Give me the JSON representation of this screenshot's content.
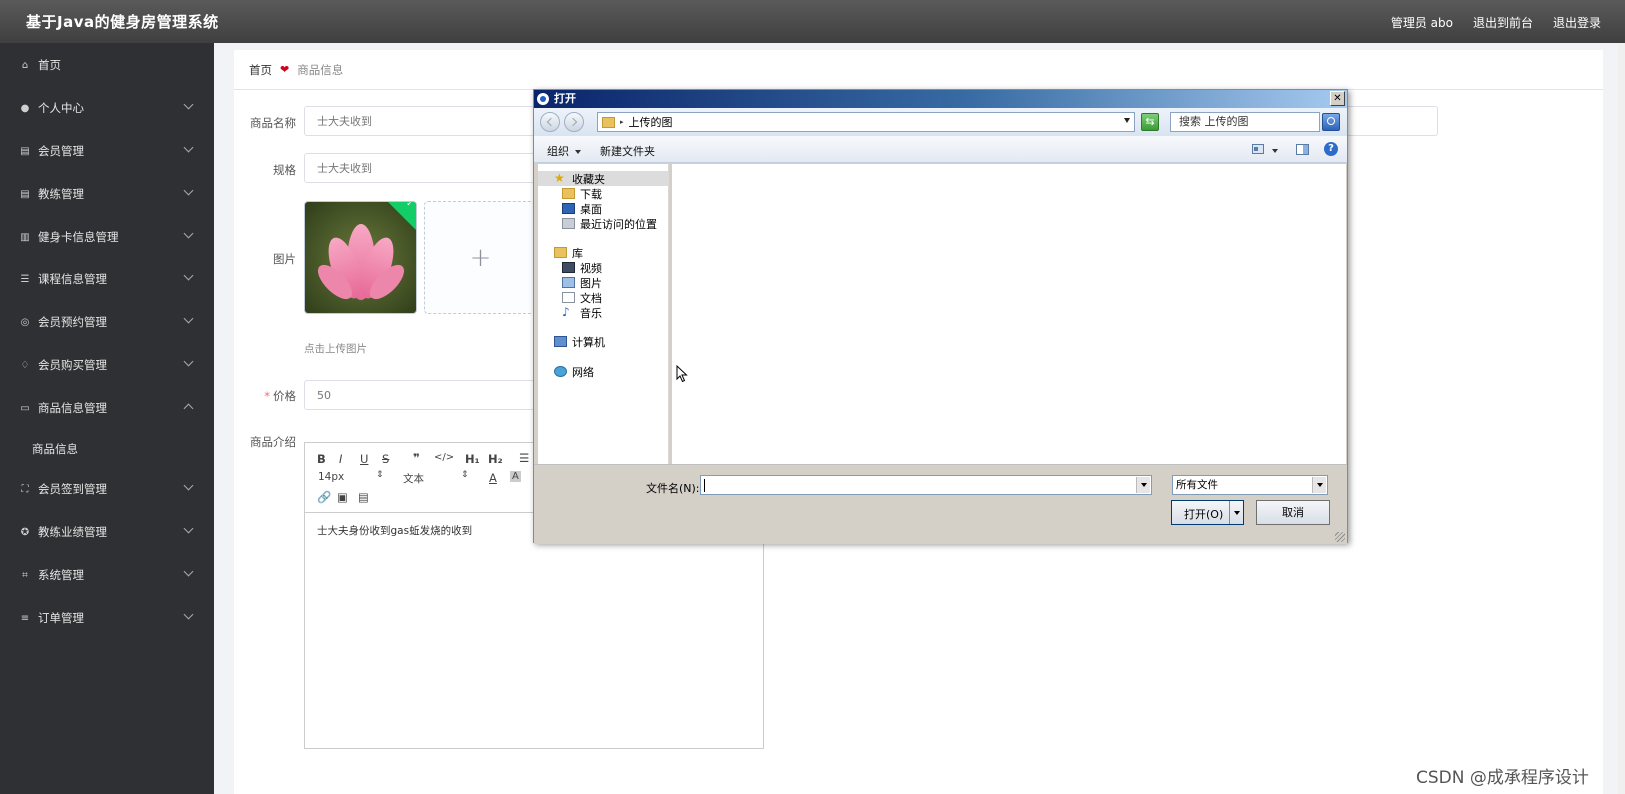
{
  "header": {
    "title": "基于Java的健身房管理系统",
    "admin": "管理员 abo",
    "front": "退出到前台",
    "logout": "退出登录"
  },
  "sidebar": {
    "items": [
      {
        "label": "首页",
        "icon": "home-icon"
      },
      {
        "label": "个人中心",
        "icon": "user-icon"
      },
      {
        "label": "会员管理",
        "icon": "clipboard-icon"
      },
      {
        "label": "教练管理",
        "icon": "clipboard-icon"
      },
      {
        "label": "健身卡信息管理",
        "icon": "chart-icon"
      },
      {
        "label": "课程信息管理",
        "icon": "list-icon"
      },
      {
        "label": "会员预约管理",
        "icon": "gear-icon"
      },
      {
        "label": "会员购买管理",
        "icon": "bell-icon"
      },
      {
        "label": "商品信息管理",
        "icon": "chat-icon"
      },
      {
        "label": "会员签到管理",
        "icon": "fullscreen-icon"
      },
      {
        "label": "教练业绩管理",
        "icon": "globe-icon"
      },
      {
        "label": "系统管理",
        "icon": "crop-icon"
      },
      {
        "label": "订单管理",
        "icon": "sliders-icon"
      }
    ],
    "sub_item": "商品信息"
  },
  "breadcrumb": {
    "home": "首页",
    "current": "商品信息"
  },
  "form": {
    "name_label": "商品名称",
    "name_value": "士大夫收到",
    "spec_label": "规格",
    "spec_value": "士大夫收到",
    "image_label": "图片",
    "upload_tip": "点击上传图片",
    "price_required": "*",
    "price_label": "价格",
    "price_value": "50",
    "intro_label": "商品介绍",
    "intro_text": "士大夫身份收到gas蚯发烧的收到",
    "font_size": "14px",
    "font_type": "文本"
  },
  "dialog": {
    "title": "打开",
    "path": "上传的图",
    "search_placeholder": "搜索 上传的图",
    "organize": "组织",
    "new_folder": "新建文件夹",
    "nav": [
      {
        "label": "收藏夹",
        "icon": "star-icon"
      },
      {
        "label": "下载",
        "icon": "download-folder-icon"
      },
      {
        "label": "桌面",
        "icon": "desktop-icon"
      },
      {
        "label": "最近访问的位置",
        "icon": "recent-places-icon"
      },
      {
        "label": "库",
        "icon": "library-icon"
      },
      {
        "label": "视频",
        "icon": "video-icon"
      },
      {
        "label": "图片",
        "icon": "picture-icon"
      },
      {
        "label": "文档",
        "icon": "document-icon"
      },
      {
        "label": "音乐",
        "icon": "music-icon"
      },
      {
        "label": "计算机",
        "icon": "computer-icon"
      },
      {
        "label": "网络",
        "icon": "network-icon"
      }
    ],
    "filename_label": "文件名(N):",
    "filename_value": "",
    "filetype": "所有文件",
    "open": "打开(O)",
    "cancel": "取消"
  },
  "watermark": "CSDN @成承程序设计"
}
